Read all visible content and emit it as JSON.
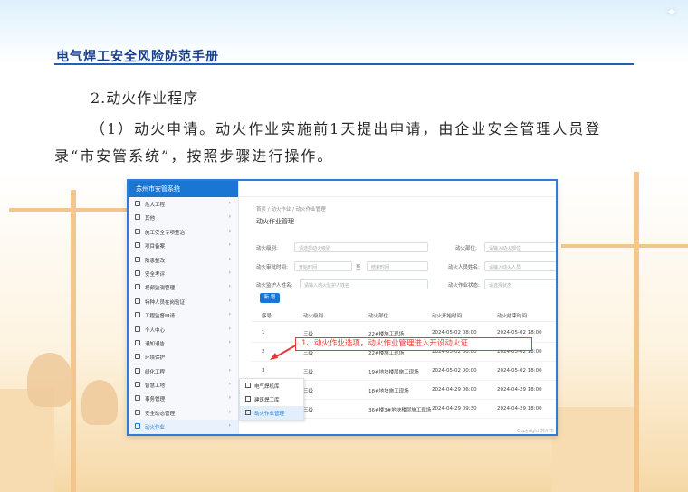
{
  "header": {
    "title": "电气焊工安全风险防范手册"
  },
  "heading": "2.动火作业程序",
  "paragraph": "（1）动火申请。动火作业实施前1天提出申请，由企业安全管理人员登录“市安管系统”，按照步骤进行操作。",
  "screenshot": {
    "app_title": "苏州市安管系统",
    "sidebar": [
      {
        "label": "危大工程"
      },
      {
        "label": "其他"
      },
      {
        "label": "施工安全专项整治"
      },
      {
        "label": "项目备案"
      },
      {
        "label": "隐患整改"
      },
      {
        "label": "安全考评"
      },
      {
        "label": "视频监测管理"
      },
      {
        "label": "特种人员在岗验证"
      },
      {
        "label": "工程监督申请"
      },
      {
        "label": "个人中心"
      },
      {
        "label": "通知通告"
      },
      {
        "label": "环境保护"
      },
      {
        "label": "绿化工程"
      },
      {
        "label": "智慧工地"
      },
      {
        "label": "事务管理"
      },
      {
        "label": "安全动态管理"
      },
      {
        "label": "动火作业"
      }
    ],
    "submenu": [
      {
        "label": "电气焊机库"
      },
      {
        "label": "建筑焊工库"
      },
      {
        "label": "动火作业管理"
      }
    ],
    "breadcrumb": "首页 / 动火作业 / 动火作业管理",
    "page_title": "动火作业管理",
    "form": {
      "level_label": "动火级别:",
      "level_placeholder": "请选择动火级别",
      "part_label": "动火部位:",
      "part_placeholder": "请输入动火部位",
      "time_label": "动火审批时间:",
      "time_start": "开始时间",
      "time_sep": "至",
      "time_end": "结束时间",
      "person_label": "动火人员姓名:",
      "person_placeholder": "请输入动火人员",
      "guard_label": "动火监护人姓名:",
      "guard_placeholder": "请输入动火监护人姓名",
      "status_label": "动火作业状态:",
      "status_placeholder": "请选择状态",
      "add_button": "新 增"
    },
    "columns": [
      "序号",
      "动火级别",
      "动火部位",
      "动火开始时间",
      "动火结束时间"
    ],
    "rows": [
      {
        "no": "1",
        "level": "三级",
        "part": "22#楼施工现场",
        "start": "2024-05-02 08:00",
        "end": "2024-05-02 18:00"
      },
      {
        "no": "2",
        "level": "三级",
        "part": "22#楼施工现场",
        "start": "2024-05-02 00:00",
        "end": "2024-05-02 18:00"
      },
      {
        "no": "3",
        "level": "三级",
        "part": "19#地块楼层施工现场",
        "start": "2024-05-02 00:00",
        "end": "2024-05-02 18:00"
      },
      {
        "no": "4",
        "level": "三级",
        "part": "18#地块施工现场",
        "start": "2024-04-29 06:00",
        "end": "2024-04-29 18:00"
      },
      {
        "no": "5",
        "level": "三级",
        "part": "36#楼3#地块楼层施工现场",
        "start": "2024-04-29 09:30",
        "end": "2024-04-29 18:00"
      }
    ],
    "footer": "Copyright 苏州市"
  },
  "callout": "1、动火作业选项，动火作业管理进入开设动火证",
  "colors": {
    "brand": "#1976d2",
    "accent_red": "#e53935",
    "header_line": "#1f5fb5"
  }
}
